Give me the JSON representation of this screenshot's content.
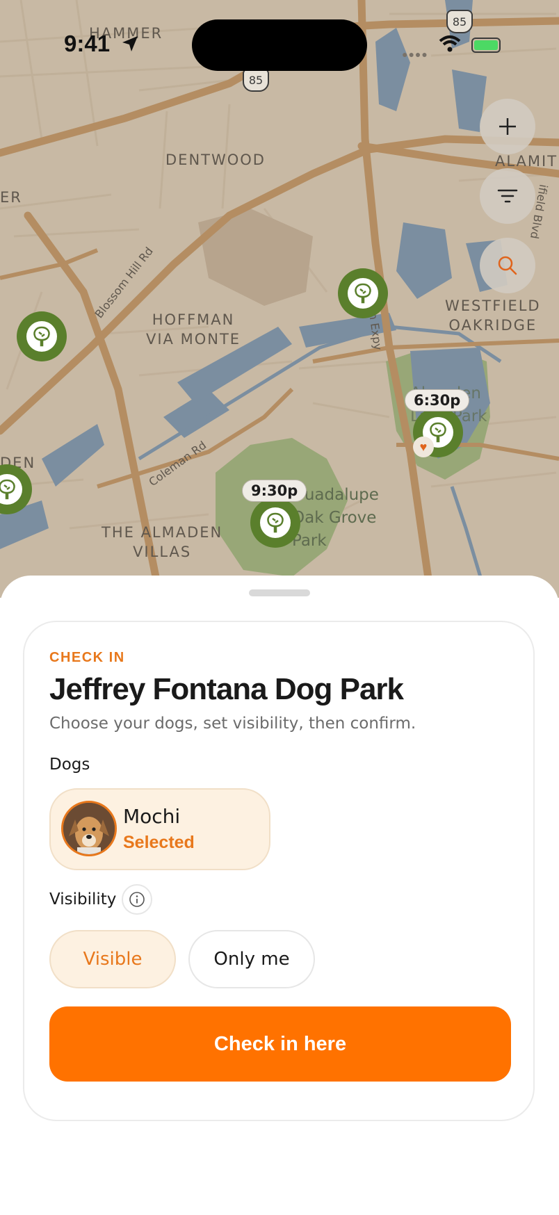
{
  "status_bar": {
    "time": "9:41"
  },
  "map": {
    "neighborhoods": [
      "HAMMER",
      "DENTWOOD",
      "ALAMIT",
      "ER",
      "HOFFMAN\nVIA MONTE",
      "WESTFIELD\nOAKRIDGE",
      "DEN",
      "THE ALMADEN\nVILLAS"
    ],
    "roads": [
      "Blossom Hill Rd",
      "Coleman Rd",
      "Almaden Expy",
      "ifield Blvd"
    ],
    "parks": [
      "Almaden\nLake Park",
      "Guadalupe\nOak Grove\nPark"
    ],
    "route_shields": [
      "85",
      "85"
    ],
    "time_badges": [
      "6:30p",
      "9:30p"
    ],
    "icons": [
      "tree-icon",
      "heart-icon",
      "plus-icon",
      "filter-icon",
      "search-icon",
      "location-arrow-icon"
    ]
  },
  "sheet": {
    "eyebrow": "CHECK IN",
    "title": "Jeffrey Fontana Dog Park",
    "subtitle": "Choose your dogs, set visibility, then confirm.",
    "dogs_heading": "Dogs",
    "dogs": [
      {
        "name": "Mochi",
        "status": "Selected"
      }
    ],
    "visibility_heading": "Visibility",
    "visibility_options": [
      "Visible",
      "Only me"
    ],
    "visibility_selected": "Visible",
    "cta": "Check in here"
  },
  "colors": {
    "accent": "#ff7200",
    "accent_text": "#e8781c",
    "pin_green": "#5a7f2c",
    "map_bg": "#c8b9a4",
    "water": "#7b8ea0",
    "park": "#98a777"
  }
}
